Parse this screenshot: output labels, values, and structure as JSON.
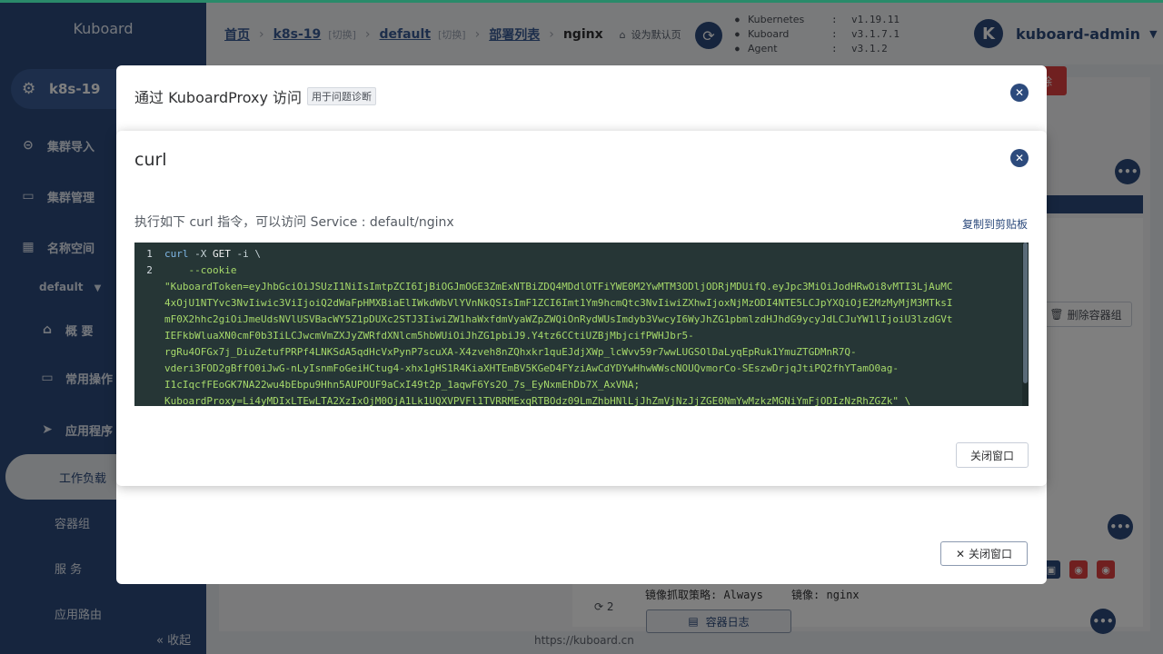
{
  "sidebar": {
    "brand": "Kuboard",
    "cluster": "k8s-19",
    "items": [
      {
        "label": "集群导入",
        "icon": "link-icon"
      },
      {
        "label": "集群管理",
        "icon": "folder-icon"
      },
      {
        "label": "名称空间",
        "icon": "grid-icon"
      }
    ],
    "namespace": "default",
    "sub_items": [
      {
        "label": "概 要",
        "icon": "home-icon"
      },
      {
        "label": "常用操作",
        "icon": "folder-icon"
      },
      {
        "label": "应用程序",
        "icon": "send-icon"
      }
    ],
    "leaves": [
      "工作负载",
      "容器组",
      "服 务",
      "应用路由"
    ],
    "collapse_label": "收起"
  },
  "header": {
    "crumbs": {
      "home": "首页",
      "cluster": "k8s-19",
      "switch1": "[切换]",
      "namespace": "default",
      "switch2": "[切换]",
      "deploy_list": "部署列表",
      "current": "nginx",
      "set_default": "设为默认页"
    },
    "versions": [
      {
        "name": "Kubernetes",
        "value": "v1.19.11"
      },
      {
        "name": "Kuboard",
        "value": "v3.1.7.1"
      },
      {
        "name": "Agent",
        "value": "v3.1.2"
      }
    ],
    "user": {
      "avatar_letter": "K",
      "name": "kuboard-admin"
    }
  },
  "background": {
    "delete_container_label": "删除容器组",
    "pull_policy": "镜像抓取策略: Always",
    "image": "镜像: nginx",
    "restart_count": "2",
    "log_button": "容器日志",
    "delete_short": "除",
    "footer_url": "https://kuboard.cn"
  },
  "dialog_proxy": {
    "title": "通过 KuboardProxy 访问",
    "tag": "用于问题诊断",
    "close_button": "关闭窗口"
  },
  "dialog_curl": {
    "title": "curl",
    "description": "执行如下 curl 指令，可以访问 Service : default/nginx",
    "copy_label": "复制到剪贴板",
    "close_button": "关闭窗口",
    "code": {
      "line1_num": "1",
      "line1_cmd": "curl",
      "line1_opt": " -X ",
      "line1_method": "GET",
      "line1_rest": " -i \\",
      "line2_num": "2",
      "line2_opt": "    --cookie",
      "wrapped": [
        "\"KuboardToken=eyJhbGciOiJSUzI1NiIsImtpZCI6IjBiOGJmOGE3ZmExNTBiZDQ4MDdlOTFiYWE0M2YwMTM3ODljODRjMDUifQ.eyJpc3MiOiJodHRwOi8vMTI3LjAuMC",
        "4xOjU1NTYvc3NvIiwic3ViIjoiQ2dWaFpHMXBiaElIWkdWbVlYVnNkQSIsImF1ZCI6Imt1Ym9hcmQtc3NvIiwiZXhwIjoxNjMzODI4NTE5LCJpYXQiOjE2MzMyMjM3MTksI",
        "mF0X2hhc2giOiJmeUdsNVlUSVBacWY5Z1pDUXc2STJ3IiwiZW1haWxfdmVyaWZpZWQiOnRydWUsImdyb3VwcyI6WyJhZG1pbmlzdHJhdG9ycyJdLCJuYW1lIjoiU3lzdGVt",
        "IEFkbWluaXN0cmF0b3IiLCJwcmVmZXJyZWRfdXNlcm5hbWUiOiJhZG1pbiJ9.Y4tz6CCtiUZBjMbjcifPWHJbr5-",
        "rgRu4OFGx7j_DiuZetufPRPf4LNKSdA5qdHcVxPynP7scuXA-X4zveh8nZQhxkr1quEJdjXWp_lcWvv59r7wwLUGSOlDaLyqEpRuk1YmuZTGDMnR7Q-",
        "vderi3FOD2gBffO0iJwG-nLyIsnmFoGeiHCtug4-xhx1gHS1R4KiaXHTEmBV5KGeD4FYziAwCdYDYwHhwWWscNOUQvmorCo-SEszwDrjqJtiPQ2fhYTamO0ag-",
        "I1cIqcfFEoGK7NA22wu4bEbpu9Hhn5AUPOUF9aCxI49t2p_1aqwF6Ys2O_7s_EyNxmEhDb7X_AxVNA;",
        "KuboardProxy=Li4yMDIxLTEwLTA2XzIxOjM0OjA1Lk1UQXVPVFl1TVRRMExqRTBOdz09LmZhbHNlLjJhZmVjNzJjZGE0NmYwMzkzMGNiYmFjODIzNzRhZGZk\" \\"
      ]
    }
  },
  "colors": {
    "primary": "#2c4a7c",
    "danger": "#e04040",
    "code_bg": "#263636",
    "accent_top": "#2a8a6a"
  }
}
